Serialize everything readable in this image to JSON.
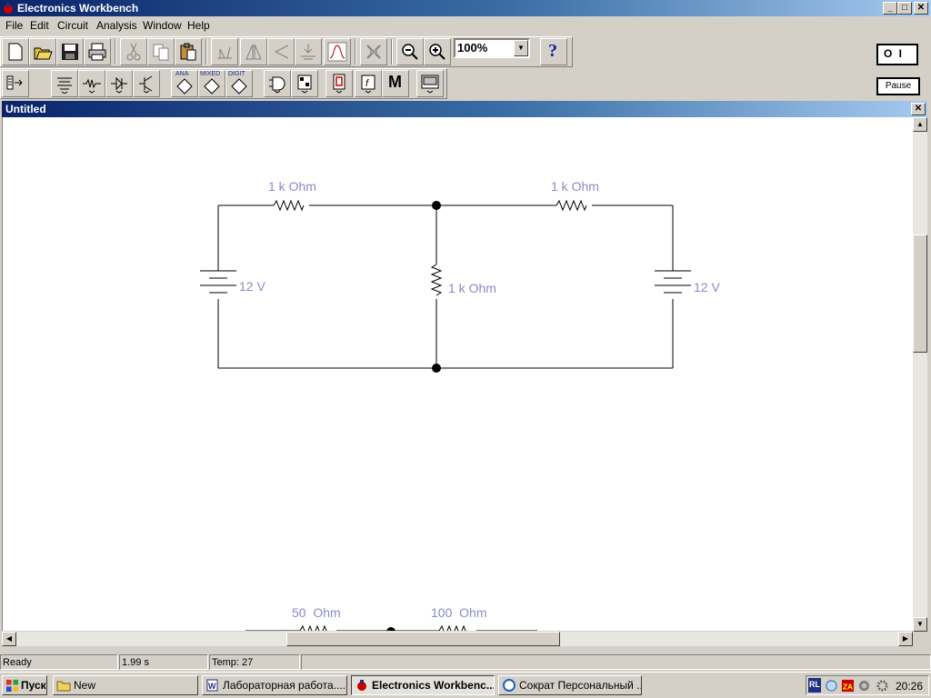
{
  "window": {
    "title": "Electronics Workbench",
    "controls": [
      "_",
      "□",
      "✕"
    ]
  },
  "menu": [
    "File",
    "Edit",
    "Circuit",
    "Analysis",
    "Window",
    "Help"
  ],
  "toolbar": {
    "zoom_value": "100%",
    "help_label": "?",
    "pause_label": "Pause",
    "power_label": "O I",
    "bin_labels": [
      "ANA",
      "MIXED",
      "DIGIT"
    ],
    "indicator_label": "M",
    "icons": [
      "new-icon",
      "open-icon",
      "save-icon",
      "print-icon",
      "cut-icon",
      "copy-icon",
      "paste-icon",
      "rotate-icon",
      "flip-horizontal-icon",
      "flip-vertical-icon",
      "subcircuit-icon",
      "graph-icon",
      "component-properties-icon",
      "zoom-out-icon",
      "zoom-in-icon"
    ]
  },
  "document": {
    "title": "Untitled",
    "close": "✕"
  },
  "circuit": {
    "resistor_top_left": "1 k Ohm",
    "resistor_top_right": "1 k Ohm",
    "resistor_middle": "1 k Ohm",
    "battery_left": "12 V",
    "battery_right": "12 V",
    "lower_resistor_1": "50  Ohm",
    "lower_resistor_2": "100  Ohm"
  },
  "status": {
    "state": "Ready",
    "time": "1.99 s",
    "temp": "Temp:  27"
  },
  "taskbar": {
    "start": "Пуск",
    "tasks": [
      "New",
      "Лабораторная работа....",
      "Electronics Workbenc...",
      "Сократ Персональный ..."
    ],
    "tray_lang": "RL",
    "clock": "20:26"
  },
  "colors": {
    "label_color": "#8a8ac8",
    "title_gradient_start": "#0a246a",
    "title_gradient_end": "#a6caf0"
  }
}
